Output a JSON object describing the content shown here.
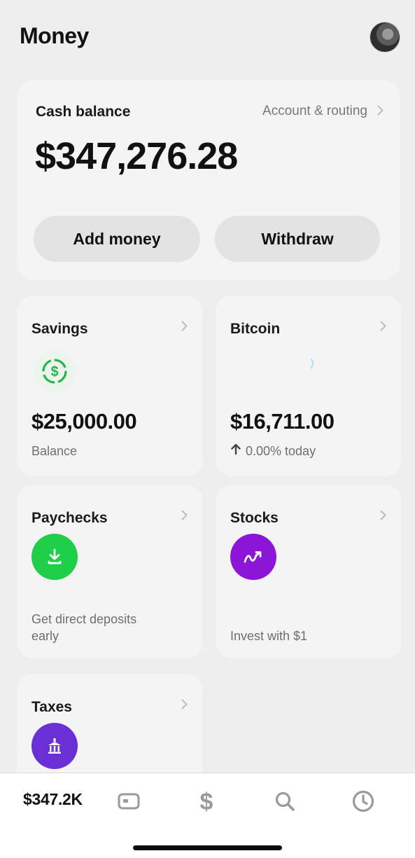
{
  "header": {
    "title": "Money"
  },
  "cash": {
    "label": "Cash balance",
    "account_link": "Account & routing",
    "amount": "$347,276.28",
    "add_label": "Add money",
    "withdraw_label": "Withdraw"
  },
  "tiles": {
    "savings": {
      "title": "Savings",
      "amount": "$25,000.00",
      "sub": "Balance",
      "icon": "dollar-circle-icon",
      "color": "#2bb24c"
    },
    "bitcoin": {
      "title": "Bitcoin",
      "amount": "$16,711.00",
      "change": "0.00% today",
      "icon": "loading-spinner-icon"
    },
    "paychecks": {
      "title": "Paychecks",
      "desc_line1": "Get direct deposits",
      "desc_line2": "early",
      "icon": "download-icon",
      "color": "#1fcf49"
    },
    "stocks": {
      "title": "Stocks",
      "desc": "Invest with $1",
      "icon": "trend-up-icon",
      "color": "#8b16d8"
    },
    "taxes": {
      "title": "Taxes",
      "icon": "bank-building-icon",
      "color": "#6b2fd6"
    }
  },
  "tabbar": {
    "balance": "$347.2K",
    "icons": [
      "card-icon",
      "dollar-icon",
      "search-icon",
      "clock-icon"
    ]
  }
}
